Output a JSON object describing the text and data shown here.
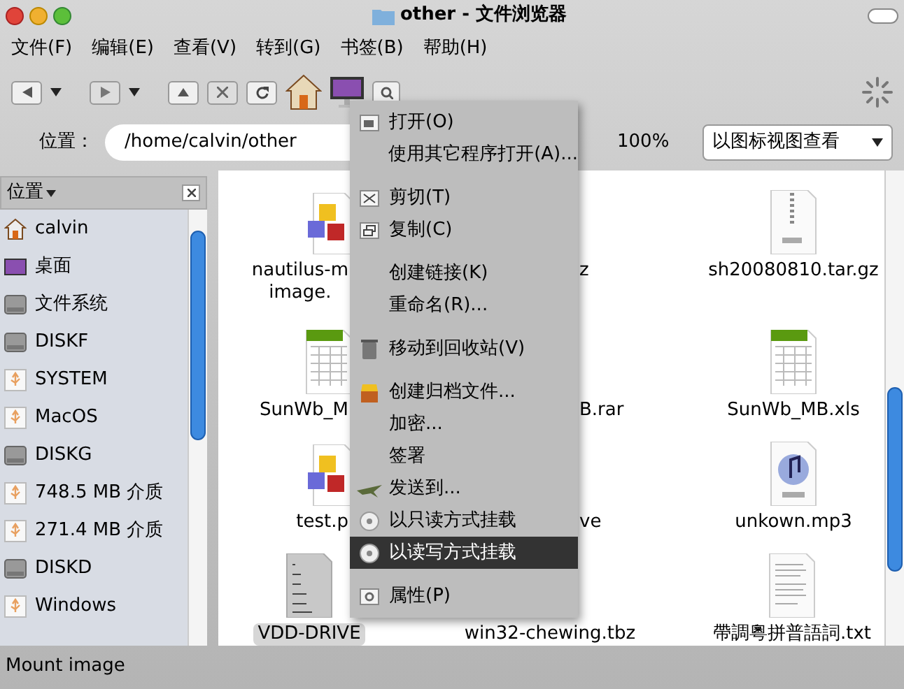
{
  "window": {
    "title": "other - 文件浏览器"
  },
  "menu_bar": [
    "文件(F)",
    "编辑(E)",
    "查看(V)",
    "转到(G)",
    "书签(B)",
    "帮助(H)"
  ],
  "location": {
    "label": "位置：",
    "path": "/home/calvin/other",
    "zoom": "100%",
    "view": "以图标视图查看"
  },
  "sidebar": {
    "title": "位置",
    "items": [
      {
        "label": "calvin",
        "kind": "home"
      },
      {
        "label": "桌面",
        "kind": "desktop"
      },
      {
        "label": "文件系统",
        "kind": "disk"
      },
      {
        "label": "DISKF",
        "kind": "disk"
      },
      {
        "label": "SYSTEM",
        "kind": "usb"
      },
      {
        "label": "MacOS",
        "kind": "usb"
      },
      {
        "label": "DISKG",
        "kind": "disk"
      },
      {
        "label": "748.5 MB 介质",
        "kind": "usb"
      },
      {
        "label": "271.4 MB 介质",
        "kind": "usb"
      },
      {
        "label": "DISKD",
        "kind": "disk"
      },
      {
        "label": "Windows",
        "kind": "usb"
      }
    ]
  },
  "files": [
    {
      "lines": [
        "nautilus-m",
        "image."
      ],
      "kind": "package",
      "selected": false
    },
    {
      "lines": [
        "z"
      ],
      "kind": "covered",
      "selected": false
    },
    {
      "lines": [
        "sh20080810.tar.gz"
      ],
      "kind": "archive",
      "selected": false
    },
    {
      "lines": [
        "SunWb_M"
      ],
      "kind": "spreadsheet",
      "selected": false
    },
    {
      "lines": [
        "B.rar"
      ],
      "kind": "covered",
      "selected": false
    },
    {
      "lines": [
        "SunWb_MB.xls"
      ],
      "kind": "spreadsheet",
      "selected": false
    },
    {
      "lines": [
        "test.p"
      ],
      "kind": "package",
      "selected": false
    },
    {
      "lines": [
        "ve"
      ],
      "kind": "covered",
      "selected": false
    },
    {
      "lines": [
        "unkown.mp3"
      ],
      "kind": "music",
      "selected": false
    },
    {
      "lines": [
        "VDD-DRIVE"
      ],
      "kind": "binary",
      "selected": true
    },
    {
      "lines": [
        "win32-chewing.tbz"
      ],
      "kind": "covered",
      "selected": false
    },
    {
      "lines": [
        "帶調粵拼普語詞.txt"
      ],
      "kind": "text",
      "selected": false
    }
  ],
  "context_menu": [
    {
      "kind": "open",
      "label": "打开(O)",
      "selected": false
    },
    {
      "kind": "plain",
      "label": "使用其它程序打开(A)...",
      "selected": false
    },
    {
      "kind": "separator"
    },
    {
      "kind": "cut",
      "label": "剪切(T)",
      "selected": false
    },
    {
      "kind": "copy",
      "label": "复制(C)",
      "selected": false
    },
    {
      "kind": "separator"
    },
    {
      "kind": "plain",
      "label": "创建链接(K)",
      "selected": false
    },
    {
      "kind": "plain",
      "label": "重命名(R)...",
      "selected": false
    },
    {
      "kind": "separator"
    },
    {
      "kind": "trash",
      "label": "移动到回收站(V)",
      "selected": false
    },
    {
      "kind": "separator"
    },
    {
      "kind": "archive",
      "label": "创建归档文件...",
      "selected": false
    },
    {
      "kind": "plain",
      "label": "加密...",
      "selected": false
    },
    {
      "kind": "plain",
      "label": "签署",
      "selected": false
    },
    {
      "kind": "send",
      "label": "发送到...",
      "selected": false
    },
    {
      "kind": "disc",
      "label": "以只读方式挂载",
      "selected": false
    },
    {
      "kind": "disc",
      "label": "以读写方式挂载",
      "selected": true
    },
    {
      "kind": "separator"
    },
    {
      "kind": "properties",
      "label": "属性(P)",
      "selected": false
    }
  ],
  "status_bar": "Mount image"
}
